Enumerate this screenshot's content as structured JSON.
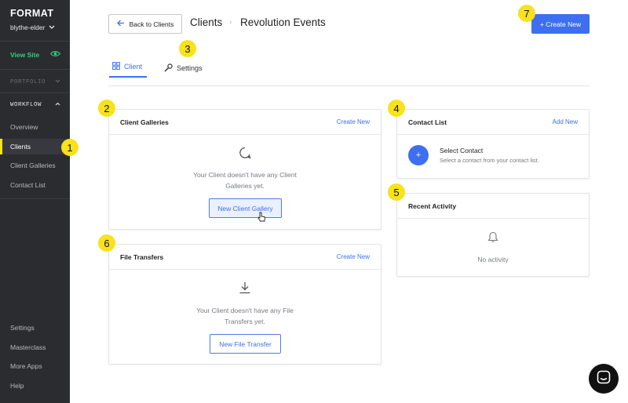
{
  "sidebar": {
    "brand": "FORMAT",
    "account": "blythe-elder",
    "view_site": "View Site",
    "portfolio_label": "PORTFOLIO",
    "workflow_label": "WORKFLOW",
    "workflow_items": [
      {
        "label": "Overview"
      },
      {
        "label": "Clients",
        "active": true
      },
      {
        "label": "Client Galleries"
      },
      {
        "label": "Contact List"
      }
    ],
    "bottom_items": [
      {
        "label": "Settings"
      },
      {
        "label": "Masterclass"
      },
      {
        "label": "More Apps"
      },
      {
        "label": "Help"
      }
    ]
  },
  "header": {
    "back_button": "Back to Clients",
    "breadcrumb": [
      "Clients",
      "Revolution Events"
    ],
    "create_button": "+ Create New"
  },
  "tabs": [
    {
      "label": "Client",
      "active": true,
      "icon": "grid-icon"
    },
    {
      "label": "Settings",
      "active": false,
      "icon": "wrench-icon"
    }
  ],
  "cards": {
    "client_galleries": {
      "title": "Client Galleries",
      "link": "Create New",
      "empty_line1": "Your Client doesn't have any Client",
      "empty_line2": "Galleries yet.",
      "button": "New Client Gallery"
    },
    "file_transfers": {
      "title": "File Transfers",
      "link": "Create New",
      "empty_line1": "Your Client doesn't have any File",
      "empty_line2": "Transfers yet.",
      "button": "New File Transfer"
    },
    "contact_list": {
      "title": "Contact List",
      "link": "Add New",
      "select_title": "Select Contact",
      "select_sub": "Select a contact from your contact list.",
      "plus": "+"
    },
    "recent_activity": {
      "title": "Recent Activity",
      "empty": "No activity"
    }
  },
  "badges": [
    "1",
    "2",
    "3",
    "4",
    "5",
    "6",
    "7"
  ],
  "colors": {
    "sidebar_bg": "#2b2c30",
    "accent": "#3d6ff0",
    "view_site_green": "#2ed17e",
    "badge_yellow": "#f7e21b"
  }
}
